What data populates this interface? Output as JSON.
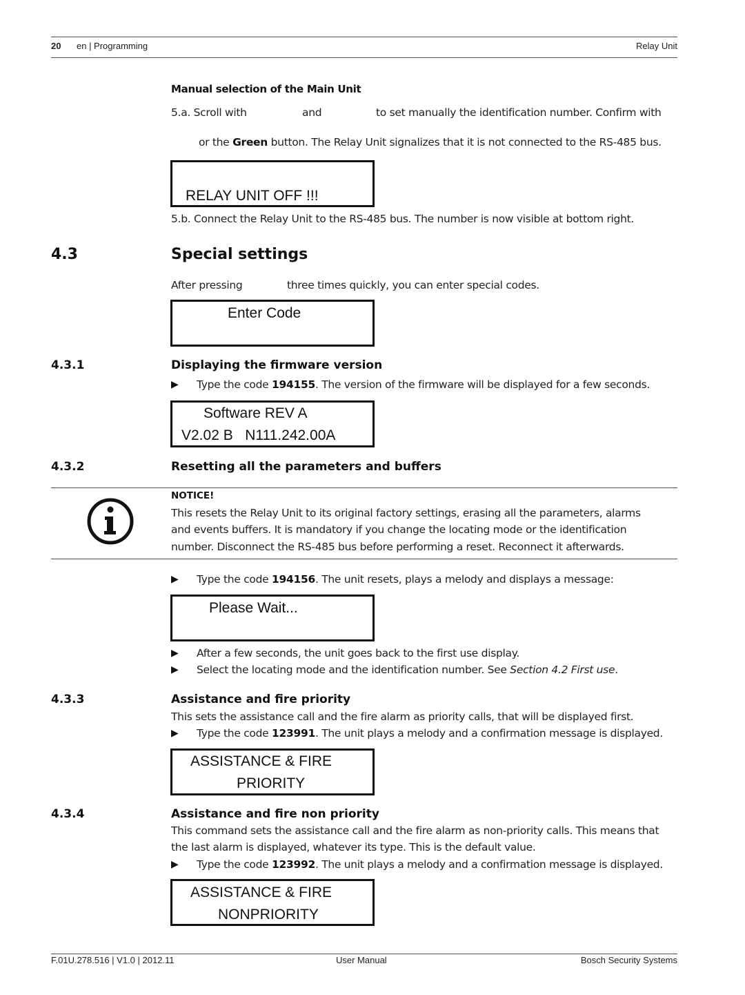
{
  "header": {
    "page_number": "20",
    "section": "en | Programming",
    "doc_title": "Relay Unit"
  },
  "manual_selection": {
    "heading": "Manual selection of the Main Unit",
    "step_5a_part1": "5.a. Scroll with",
    "step_5a_part2": "and",
    "step_5a_part3": "to set manually the identification number. Confirm with",
    "step_5a_cont_pre": "or the ",
    "step_5a_cont_bold": "Green",
    "step_5a_cont_post": " button. The Relay Unit signalizes that it is not connected to the RS-485 bus.",
    "lcd_line2": "RELAY UNIT OFF !!!",
    "step_5b": "5.b. Connect the Relay Unit to the RS-485 bus. The number is now visible at bottom right."
  },
  "section_4_3": {
    "number": "4.3",
    "title": "Special settings",
    "intro_part1": "After pressing",
    "intro_part2": "three times quickly, you can enter special codes.",
    "lcd_line1": "Enter Code"
  },
  "section_4_3_1": {
    "number": "4.3.1",
    "title": "Displaying the firmware version",
    "bullet_pre": "Type the code ",
    "bullet_code": "194155",
    "bullet_post": ". The version of the firmware will be displayed for a few seconds.",
    "lcd_line1": "Software REV A",
    "lcd_line2": "V2.02 B   N111.242.00A"
  },
  "section_4_3_2": {
    "number": "4.3.2",
    "title": "Resetting all the parameters and buffers",
    "notice_label": "NOTICE!",
    "notice_lines": [
      "This resets the Relay Unit to its original factory settings, erasing all the parameters, alarms",
      "and events buffers. It is mandatory if you change the locating mode or the identification",
      "number. Disconnect the RS-485 bus before performing a reset. Reconnect it afterwards."
    ],
    "bullet1_pre": "Type the code ",
    "bullet1_code": "194156",
    "bullet1_post": ". The unit resets, plays a melody and displays a message:",
    "lcd_line1": "Please Wait...",
    "bullet2": "After a few seconds, the unit goes back to the first use display.",
    "bullet3_pre": "Select the locating mode and the identification number. See ",
    "bullet3_ref": "Section 4.2 First use",
    "bullet3_post": "."
  },
  "section_4_3_3": {
    "number": "4.3.3",
    "title": "Assistance and fire priority",
    "desc": "This sets the assistance call and the fire alarm as priority calls, that will be displayed first.",
    "bullet_pre": "Type the code ",
    "bullet_code": "123991",
    "bullet_post": ". The unit plays a melody and a confirmation message is displayed.",
    "lcd_line1": "ASSISTANCE & FIRE",
    "lcd_line2": "PRIORITY"
  },
  "section_4_3_4": {
    "number": "4.3.4",
    "title": "Assistance and fire non priority",
    "desc_line1": "This command sets the assistance call and the fire alarm as non-priority calls. This means that",
    "desc_line2": "the last alarm is displayed, whatever its type. This is the default value.",
    "bullet_pre": "Type the code ",
    "bullet_code": "123992",
    "bullet_post": ". The unit plays a melody and a confirmation message is displayed.",
    "lcd_line1": "ASSISTANCE & FIRE",
    "lcd_line2": "NONPRIORITY"
  },
  "footer": {
    "doc_id": "F.01U.278.516 | V1.0 | 2012.11",
    "doc_type": "User Manual",
    "company": "Bosch Security Systems"
  },
  "icons": {
    "bullet": "▶",
    "notice": "info-icon"
  }
}
